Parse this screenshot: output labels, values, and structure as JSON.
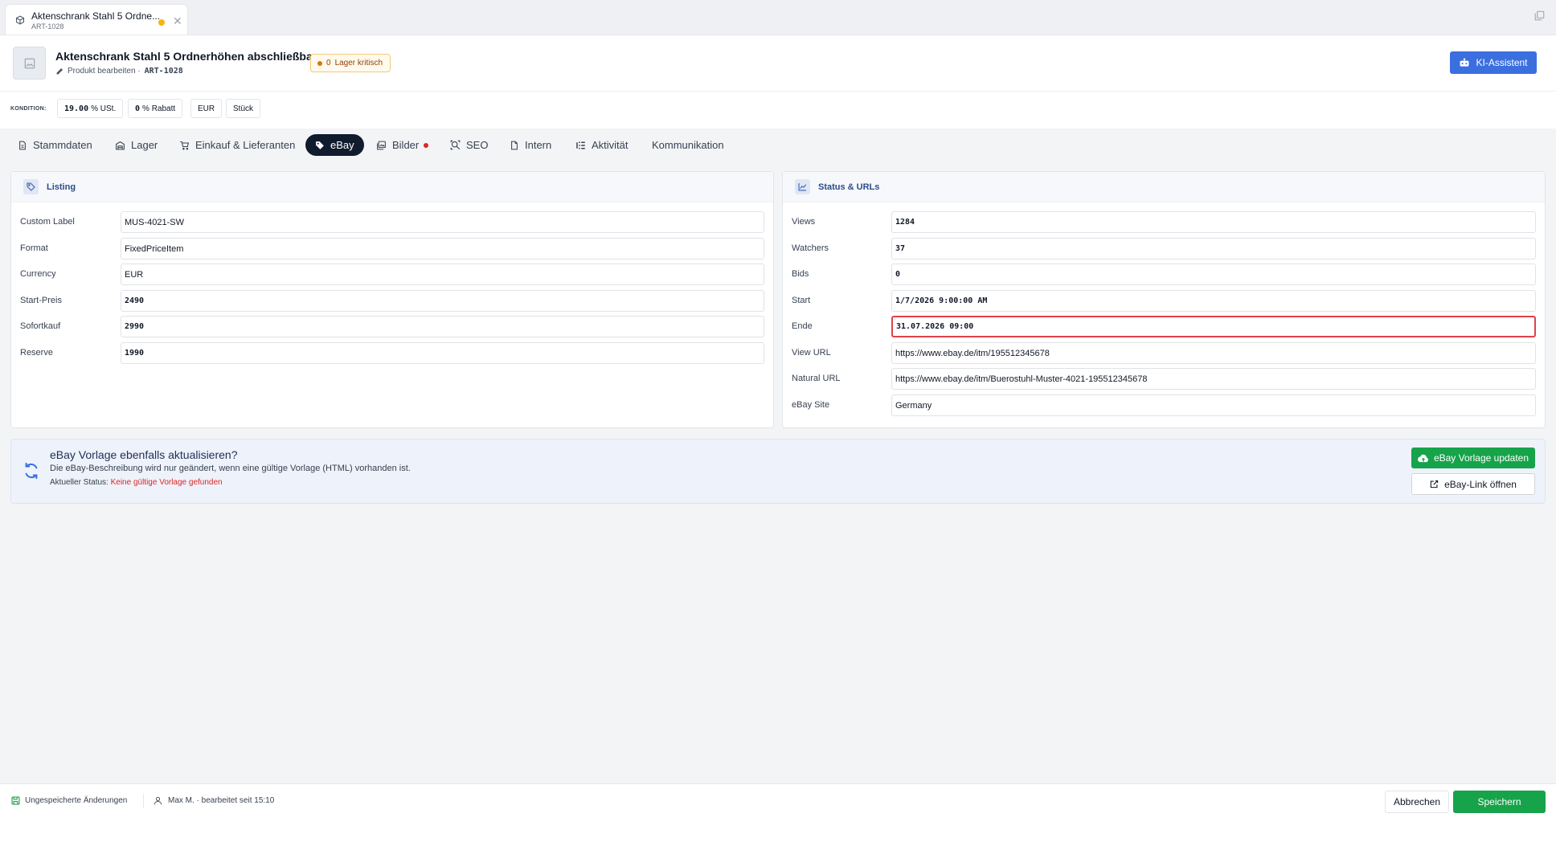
{
  "window_tab": {
    "title": "Aktenschrank Stahl 5 Ordne...",
    "sku": "ART-1028",
    "unsaved_color": "#f5b50a"
  },
  "header": {
    "title": "Aktenschrank Stahl 5 Ordnerhöhen abschließbar",
    "subtitle": "Produkt bearbeiten ·",
    "sku": "ART-1028",
    "stock_badge": {
      "count": "0",
      "label": "Lager kritisch"
    },
    "ai_button": "KI-Assistent"
  },
  "kondition": {
    "label": "KONDITION:",
    "chips": [
      {
        "value": "19.00",
        "unit": "% USt."
      },
      {
        "value": "0",
        "unit": "% Rabatt"
      },
      {
        "value": "",
        "unit": "EUR"
      },
      {
        "value": "",
        "unit": "Stück"
      }
    ]
  },
  "tabs": [
    {
      "label": "Stammdaten",
      "icon": "document-icon"
    },
    {
      "label": "Lager",
      "icon": "warehouse-icon"
    },
    {
      "label": "Einkauf & Lieferanten",
      "icon": "cart-icon"
    },
    {
      "label": "eBay",
      "icon": "tag-icon",
      "active": true
    },
    {
      "label": "Bilder",
      "icon": "images-icon",
      "dot": true
    },
    {
      "label": "SEO",
      "icon": "seo-search-icon"
    },
    {
      "label": "Intern",
      "icon": "note-icon"
    },
    {
      "label": "Aktivität",
      "icon": "activity-icon"
    },
    {
      "label": "Kommunikation",
      "icon": ""
    }
  ],
  "listing": {
    "title": "Listing",
    "fields": [
      {
        "label": "Custom Label",
        "value": "MUS-4021-SW",
        "mono": false
      },
      {
        "label": "Format",
        "value": "FixedPriceItem",
        "mono": false
      },
      {
        "label": "Currency",
        "value": "EUR",
        "mono": false
      },
      {
        "label": "Start-Preis",
        "value": "2490",
        "mono": true
      },
      {
        "label": "Sofortkauf",
        "value": "2990",
        "mono": true
      },
      {
        "label": "Reserve",
        "value": "1990",
        "mono": true
      }
    ]
  },
  "status": {
    "title": "Status & URLs",
    "fields": [
      {
        "label": "Views",
        "value": "1284",
        "mono": true
      },
      {
        "label": "Watchers",
        "value": "37",
        "mono": true
      },
      {
        "label": "Bids",
        "value": "0",
        "mono": true
      },
      {
        "label": "Start",
        "value": "1/7/2026 9:00:00 AM",
        "mono": true
      },
      {
        "label": "Ende",
        "value": "31.07.2026 09:00",
        "mono": true,
        "error": true
      },
      {
        "label": "View URL",
        "value": "https://www.ebay.de/itm/195512345678",
        "mono": false
      },
      {
        "label": "Natural URL",
        "value": "https://www.ebay.de/itm/Buerostuhl-Muster-4021-195512345678",
        "mono": false
      },
      {
        "label": "eBay Site",
        "value": "Germany",
        "mono": false
      }
    ]
  },
  "update_box": {
    "question": "eBay Vorlage ebenfalls aktualisieren?",
    "description": "Die eBay-Beschreibung wird nur geändert, wenn eine gültige Vorlage (HTML) vorhanden ist.",
    "status_label": "Aktueller Status:",
    "status_value": "Keine gültige Vorlage gefunden",
    "update_button": "eBay Vorlage updaten",
    "link_button": "eBay-Link öffnen"
  },
  "footer": {
    "unsaved": "Ungespeicherte Änderungen",
    "user": "Max M. · bearbeitet seit 15:10",
    "cancel": "Abbrechen",
    "save": "Speichern"
  },
  "colors": {
    "accent_blue": "#3b6fe0",
    "success_green": "#16a34a",
    "error_red": "#dc2626",
    "active_tab": "#111b2e"
  }
}
